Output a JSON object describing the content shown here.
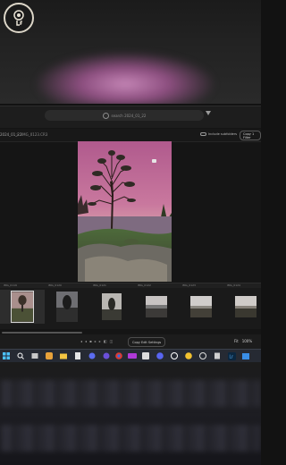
{
  "search": {
    "text": "search 2024_01_22"
  },
  "breadcrumbs": {
    "first": "2024_01_22",
    "separator": ">",
    "second": "IMG_0123.CR3"
  },
  "toolbar": {
    "include_subfolders": "Include subfolders",
    "copy_button": "Copy 1 Filter"
  },
  "filmstrip": {
    "labels": [
      "IMG_0119",
      "IMG_0120",
      "IMG_0121",
      "IMG_0122",
      "IMG_0123",
      "IMG_0124"
    ],
    "selected_index": 0
  },
  "bottombar": {
    "paging": [
      "◂",
      "◂",
      "▪",
      "▸",
      "▸",
      "◧",
      "◫"
    ],
    "copy_settings": "Copy Edit Settings",
    "fit": "Fit",
    "zoom": "100%"
  },
  "taskbar": {
    "icons": [
      "windows-icon",
      "search-icon",
      "task-view-icon",
      "widgets-icon",
      "copilot-icon",
      "file-explorer-icon",
      "notes-icon",
      "vpn-icon",
      "chrome-icon",
      "app-icon",
      "photos-icon",
      "discord-icon",
      "unreal-icon",
      "yellow-app-icon",
      "clock-icon",
      "lightroom-icon",
      "store-icon"
    ]
  },
  "colors": {
    "sky_pink": "#c9789e",
    "accent_pink": "#c586b6",
    "taskbar": "#262a33"
  }
}
